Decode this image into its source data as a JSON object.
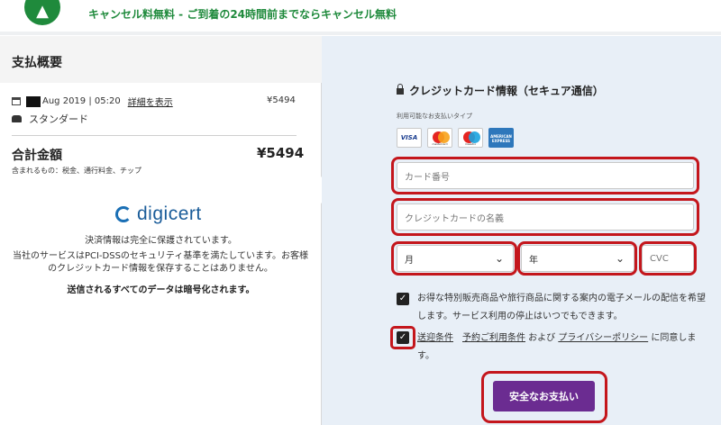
{
  "banner": {
    "icon": "thumbs-up-icon",
    "text": "キャンセル料無料 - ご到着の24時間前までならキャンセル無料",
    "color": "#1f8a3c"
  },
  "summary": {
    "title": "支払概要",
    "booking_date": "Aug 2019 | 05:20",
    "details_link": "詳細を表示",
    "booking_price": "¥5494",
    "vehicle_class": "スタンダード",
    "total_label": "合計金額",
    "total_value": "¥5494",
    "includes": "含まれるもの：税金、通行料金、チップ",
    "digicert_logo": "digicert",
    "security_line1": "決済情報は完全に保護されています。",
    "security_line2": "当社のサービスはPCI-DSSのセキュリティ基準を満たしています。お客様のクレジットカード情報を保存することはありません。",
    "security_line3": "送信されるすべてのデータは暗号化されます。"
  },
  "payment": {
    "title": "クレジットカード情報（セキュア通信）",
    "accepted_label": "利用可能なお支払いタイプ",
    "cards": [
      "VISA",
      "mastercard",
      "maestro",
      "AMERICAN EXPRESS"
    ],
    "card_number_placeholder": "カード番号",
    "card_name_placeholder": "クレジットカードの名義",
    "month_value": "月",
    "year_value": "年",
    "cvc_placeholder": "CVC",
    "newsletter_text": "お得な特別販売商品や旅行商品に関する案内の電子メールの配信を希望します。サービス利用の停止はいつでもできます。",
    "terms_link1": "送迎条件",
    "terms_link2": "予約ご利用条件",
    "terms_and": " および ",
    "terms_link3": "プライバシーポリシー",
    "terms_suffix": " に同意します。",
    "pay_button": "安全なお支払い",
    "button_color": "#6b2c91",
    "panel_color": "#e8eff7"
  },
  "annotation_color": "#c4161c"
}
